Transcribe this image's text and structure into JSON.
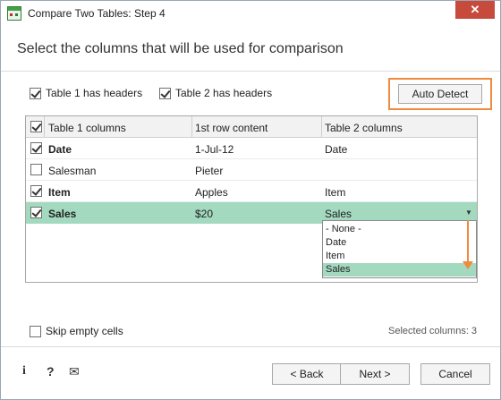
{
  "window": {
    "title": "Compare Two Tables: Step 4",
    "close_label": "✕"
  },
  "heading": "Select the columns that will be used for comparison",
  "options": {
    "table1_headers": {
      "label": "Table 1 has headers",
      "checked": true
    },
    "table2_headers": {
      "label": "Table 2 has headers",
      "checked": true
    },
    "auto_detect_label": "Auto Detect"
  },
  "grid": {
    "columns": [
      "Table 1 columns",
      "1st row content",
      "Table 2 columns"
    ],
    "header_checked": true,
    "rows": [
      {
        "checked": true,
        "table1": "Date",
        "content": "1-Jul-12",
        "table2": "Date",
        "bold": true
      },
      {
        "checked": false,
        "table1": "Salesman",
        "content": "Pieter",
        "table2": "",
        "bold": false
      },
      {
        "checked": true,
        "table1": "Item",
        "content": "Apples",
        "table2": "Item",
        "bold": true
      },
      {
        "checked": true,
        "table1": "Sales",
        "content": "$20",
        "table2": "Sales",
        "bold": true,
        "selected": true
      }
    ],
    "dropdown": {
      "options": [
        "- None -",
        "Date",
        "Item",
        "Sales"
      ],
      "selected": "Sales"
    }
  },
  "skip_empty": {
    "label": "Skip empty cells",
    "checked": false
  },
  "selected_columns": "Selected columns: 3",
  "footer": {
    "info_icon": "i",
    "help_icon": "?",
    "mail_icon": "✉",
    "back_label": "< Back",
    "next_label": "Next >",
    "cancel_label": "Cancel"
  },
  "colors": {
    "accent_orange": "#f08a3e",
    "selection_green": "#a3d9bf",
    "close_red": "#c74b3d"
  }
}
